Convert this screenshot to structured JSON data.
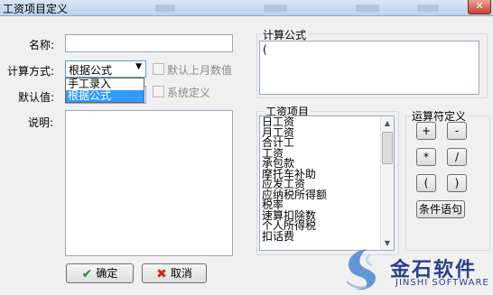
{
  "window": {
    "title": "工资项目定义",
    "close_glyph": "✕"
  },
  "form": {
    "name_label": "名称:",
    "name_value": "",
    "method_label": "计算方式:",
    "method_selected": "根据公式",
    "method_options": [
      "手工录入",
      "根据公式"
    ],
    "default_label": "默认值:",
    "desc_label": "说明:",
    "checkbox_last_month": "默认上月数值",
    "checkbox_system": "系统定义"
  },
  "formula": {
    "title": "计算公式",
    "value": "("
  },
  "salary_items": {
    "title": "工资项目",
    "items": [
      "日工资",
      "月工资",
      "合计工",
      "工资",
      "承包款",
      "摩托车补助",
      "应发工资",
      "应纳税所得额",
      "税率",
      "速算扣除数",
      "个人所得税",
      "扣话费"
    ]
  },
  "operators": {
    "title": "运算符定义",
    "buttons": [
      "+",
      "-",
      "*",
      "/",
      "(",
      ")"
    ],
    "condition_button": "条件语句"
  },
  "actions": {
    "ok_label": "确定",
    "cancel_label": "取消",
    "ok_icon": "✔",
    "cancel_icon": "✖"
  },
  "brand": {
    "name": "金石软件",
    "sub": "JINSHI SOFTWARE"
  },
  "colors": {
    "ok_icon": "#1e8a2e",
    "cancel_icon": "#c8281e",
    "selection": "#3399ff"
  }
}
